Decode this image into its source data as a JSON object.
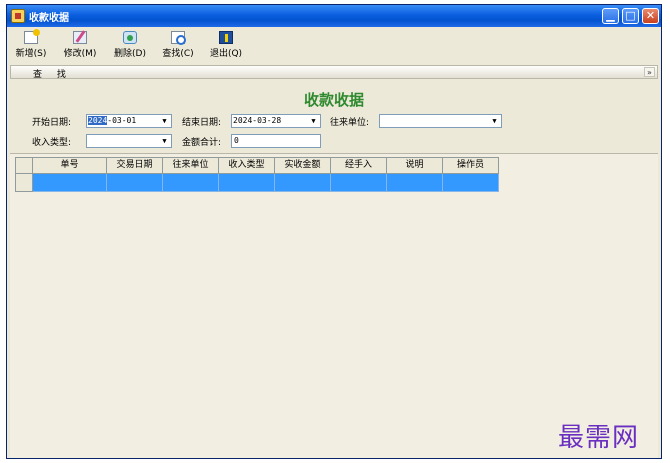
{
  "window": {
    "title": "收款收据",
    "controls": {
      "minimize": "▁",
      "maximize": "□",
      "close": "✕"
    }
  },
  "toolbar": {
    "new_label": "新增(S)",
    "edit_label": "修改(M)",
    "delete_label": "删除(D)",
    "find_label": "查找(C)",
    "exit_label": "退出(Q)"
  },
  "search_panel": {
    "label": "查 找",
    "collapse_glyph": "»"
  },
  "form": {
    "title": "收款收据",
    "title_color": "#2f8a2f",
    "start_date_label": "开始日期:",
    "start_date_value_sel": "2024",
    "start_date_value_rest": "-03-01",
    "end_date_label": "结束日期:",
    "end_date_value": "2024-03-28",
    "partner_label": "往来单位:",
    "partner_value": "",
    "income_type_label": "收入类型:",
    "income_type_value": "",
    "total_label": "金额合计:",
    "total_value": "0",
    "dropdown_glyph": "▼"
  },
  "grid": {
    "columns": [
      "单号",
      "交易日期",
      "往来单位",
      "收入类型",
      "实收金额",
      "经手入",
      "说明",
      "操作员"
    ],
    "selected_row_color": "#3399ff"
  },
  "watermark": "最需网"
}
